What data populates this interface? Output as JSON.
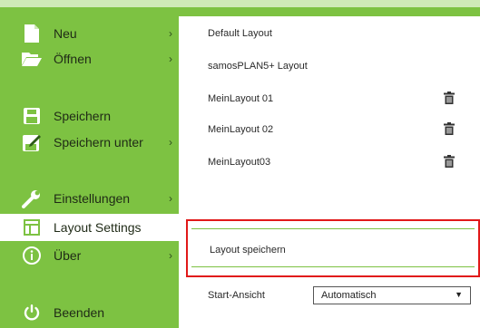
{
  "colors": {
    "accent": "#7dc242",
    "highlight_border": "#e11919"
  },
  "sidebar": {
    "items": [
      {
        "label": "Neu",
        "icon": "new-document-icon",
        "has_submenu": true
      },
      {
        "label": "Öffnen",
        "icon": "folder-open-icon",
        "has_submenu": true
      },
      {
        "label": "Speichern",
        "icon": "save-disk-icon",
        "has_submenu": false
      },
      {
        "label": "Speichern unter",
        "icon": "save-as-icon",
        "has_submenu": true
      },
      {
        "label": "Einstellungen",
        "icon": "wrench-icon",
        "has_submenu": true
      },
      {
        "label": "Layout Settings",
        "icon": "layout-icon",
        "has_submenu": false,
        "active": true
      },
      {
        "label": "Über",
        "icon": "info-icon",
        "has_submenu": true
      },
      {
        "label": "Beenden",
        "icon": "power-icon",
        "has_submenu": false
      }
    ],
    "chevron": "›"
  },
  "layouts": [
    {
      "name": "Default Layout",
      "deletable": false
    },
    {
      "name": "samosPLAN5+ Layout",
      "deletable": false
    },
    {
      "name": "MeinLayout 01",
      "deletable": true
    },
    {
      "name": "MeinLayout 02",
      "deletable": true
    },
    {
      "name": "MeinLayout03",
      "deletable": true
    }
  ],
  "save_layout_label": "Layout speichern",
  "start_view": {
    "label": "Start-Ansicht",
    "value": "Automatisch",
    "arrow": "▼"
  }
}
